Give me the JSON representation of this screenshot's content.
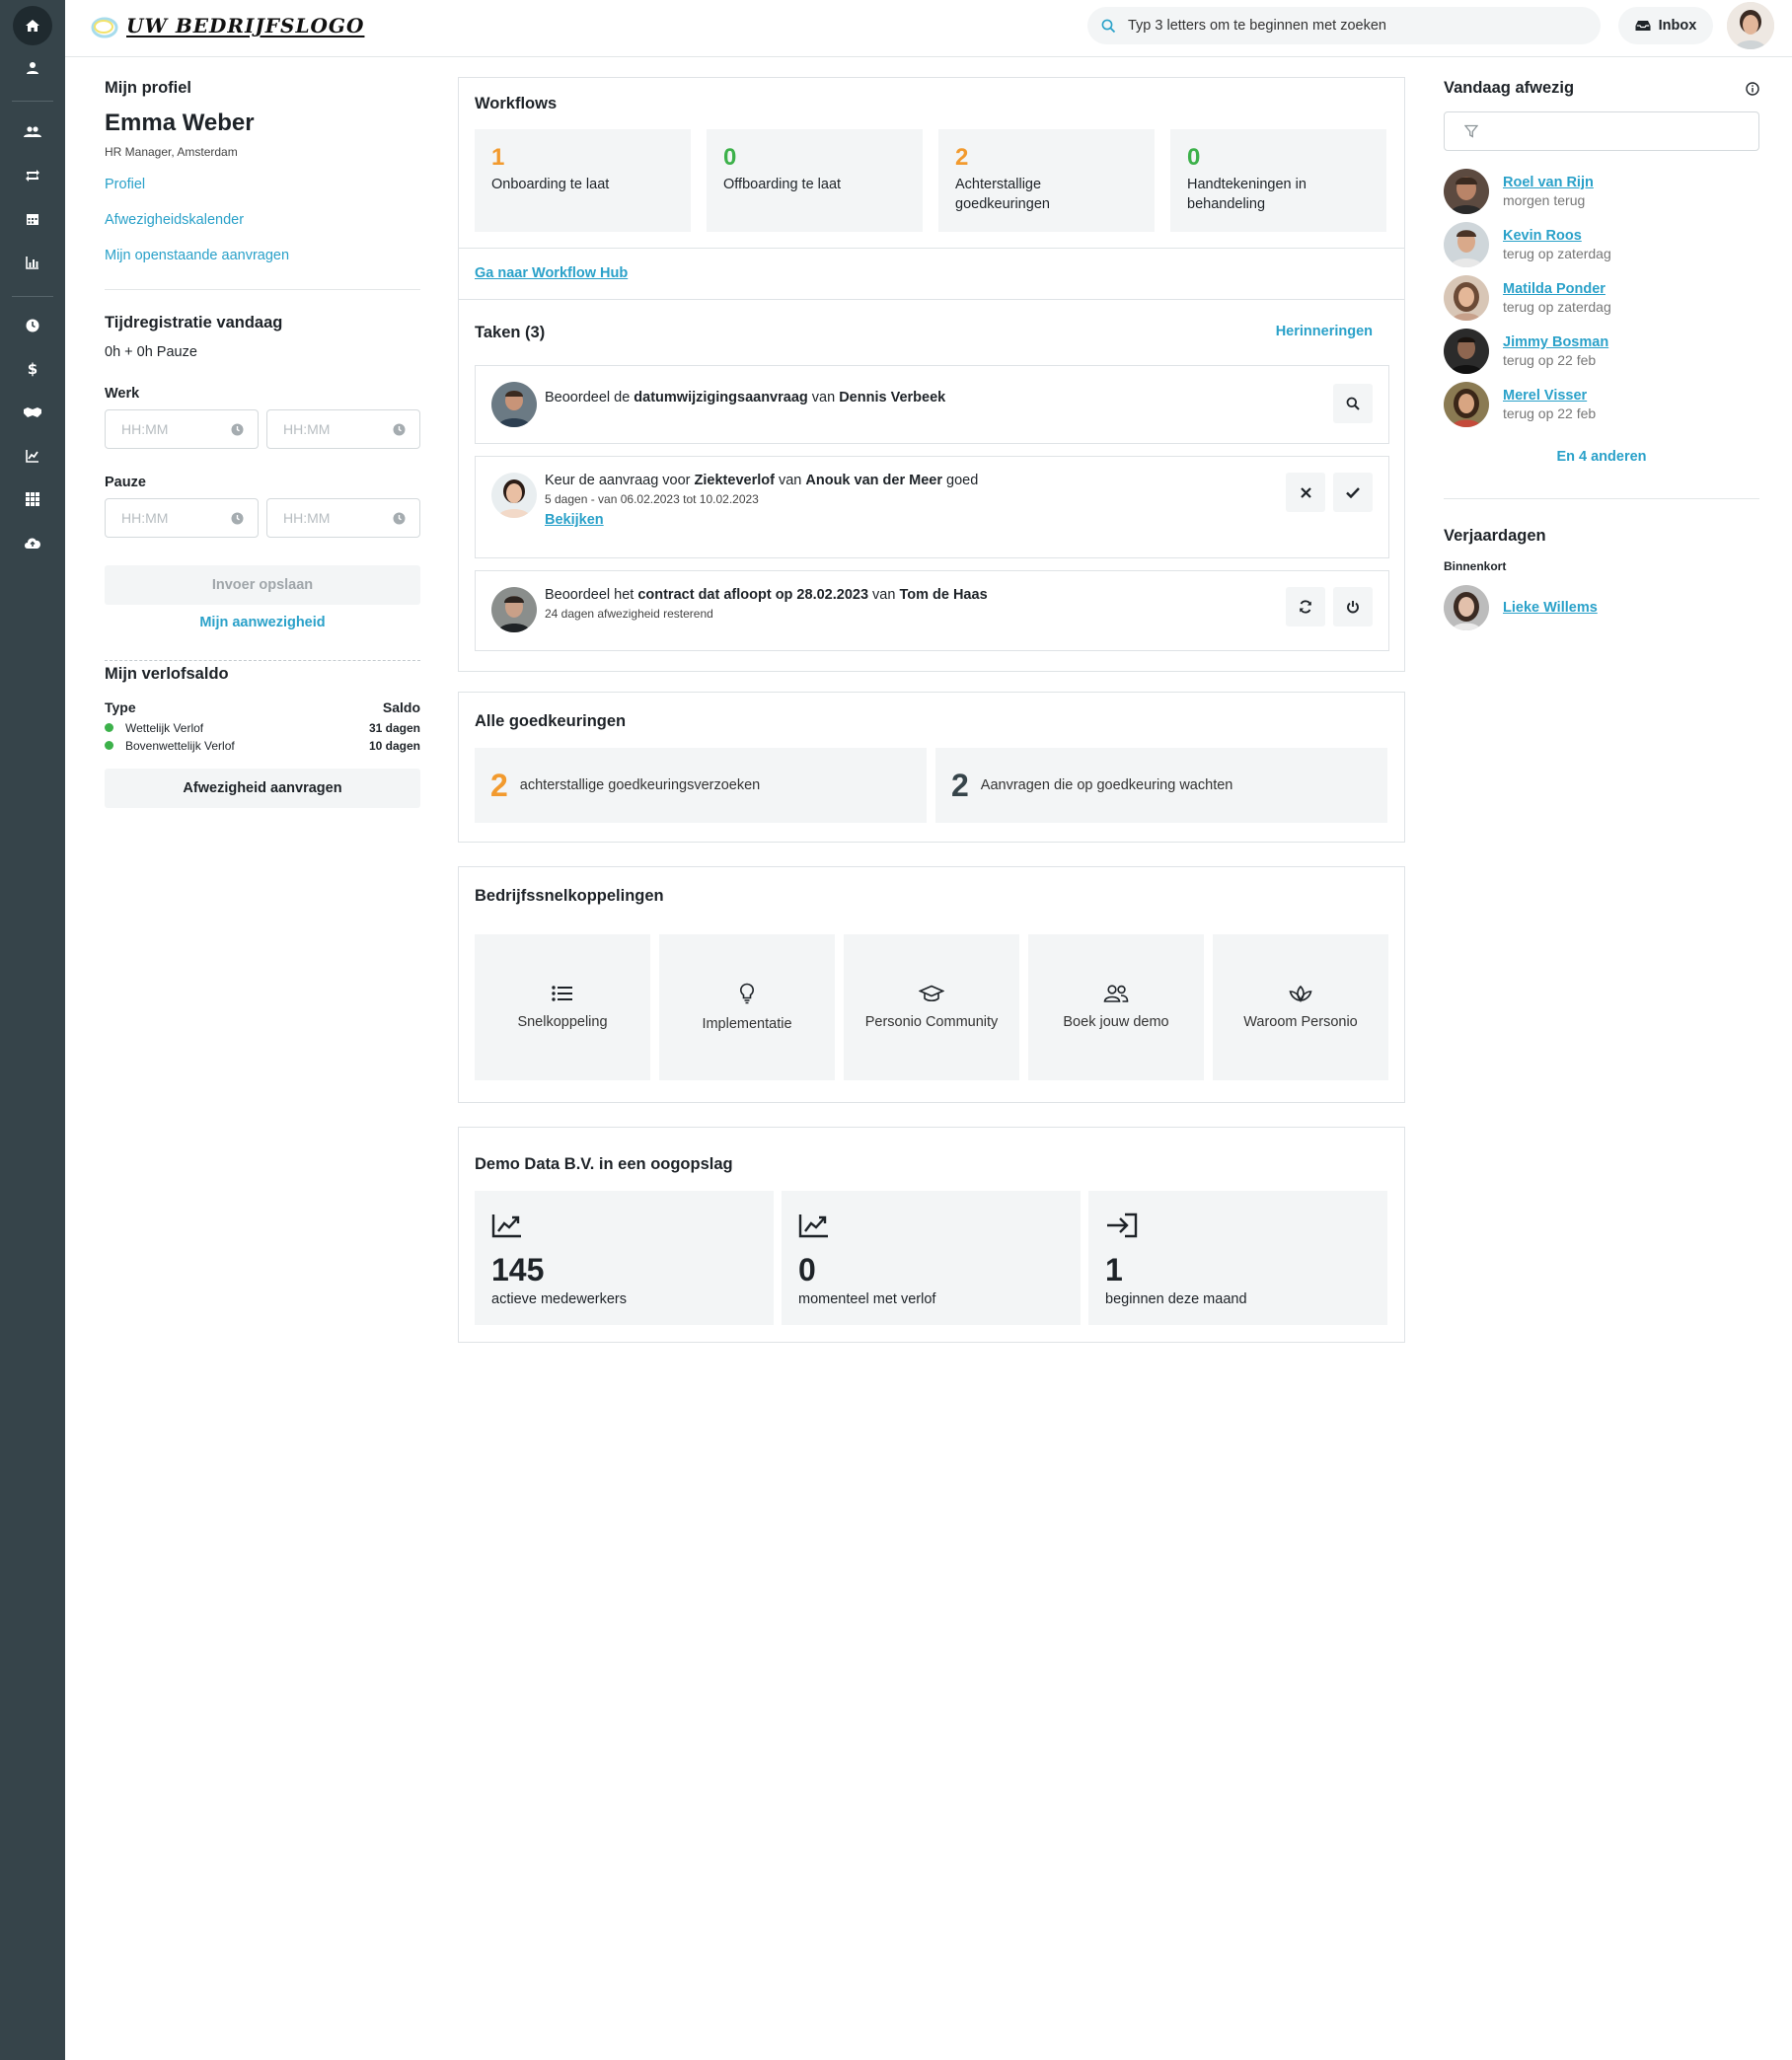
{
  "topbar": {
    "logo_text": "UW BEDRIJFSLOGO",
    "search_placeholder": "Typ 3 letters om te beginnen met zoeken",
    "inbox_label": "Inbox"
  },
  "rail": {
    "icons": [
      "home-icon",
      "person-icon",
      "people-icon",
      "switch-icon",
      "calendar-icon",
      "chart-icon",
      "clock-icon",
      "dollar-icon",
      "handshake-icon",
      "trend-icon",
      "grid-icon",
      "cloud-upload-icon"
    ]
  },
  "profile": {
    "section_title": "Mijn profiel",
    "name": "Emma Weber",
    "role": "HR Manager, Amsterdam",
    "links": [
      "Profiel",
      "Afwezigheidskalender",
      "Mijn openstaande aanvragen"
    ]
  },
  "time": {
    "title": "Tijdregistratie vandaag",
    "summary": "0h + 0h Pauze",
    "werk_label": "Werk",
    "pauze_label": "Pauze",
    "placeholder": "HH:MM",
    "save_label": "Invoer opslaan",
    "attendance_link": "Mijn aanwezigheid"
  },
  "leave": {
    "title": "Mijn verlofsaldo",
    "type_header": "Type",
    "saldo_header": "Saldo",
    "rows": [
      {
        "type": "Wettelijk Verlof",
        "saldo": "31 dagen"
      },
      {
        "type": "Bovenwettelijk Verlof",
        "saldo": "10 dagen"
      }
    ],
    "request_label": "Afwezigheid aanvragen"
  },
  "workflows": {
    "title": "Workflows",
    "tiles": [
      {
        "num": "1",
        "label": "Onboarding te laat",
        "color": "#f29a2e"
      },
      {
        "num": "0",
        "label": "Offboarding te laat",
        "color": "#3cb14a"
      },
      {
        "num": "2",
        "label": "Achterstallige goedkeuringen",
        "color": "#f29a2e"
      },
      {
        "num": "0",
        "label": "Handtekeningen in behandeling",
        "color": "#3cb14a"
      }
    ],
    "hub_link": "Ga naar Workflow Hub"
  },
  "tasks": {
    "title": "Taken (3)",
    "reminders": "Herinneringen",
    "t1": {
      "a": "Beoordeel de ",
      "b": "datumwijzigingsaanvraag",
      "c": " van ",
      "d": "Dennis Verbeek"
    },
    "t2": {
      "a": "Keur de aanvraag voor ",
      "b": "Ziekteverlof",
      "c": " van ",
      "d": "Anouk van der Meer",
      "e": " goed",
      "sub": "5 dagen - van 06.02.2023 tot 10.02.2023",
      "link": "Bekijken"
    },
    "t3": {
      "a": "Beoordeel het ",
      "b": "contract dat afloopt op 28.02.2023",
      "c": " van ",
      "d": "Tom de Haas",
      "sub": "24 dagen afwezigheid resterend"
    }
  },
  "approvals": {
    "title": "Alle goedkeuringen",
    "tiles": [
      {
        "num": "2",
        "label": "achterstallige goedkeuringsverzoeken",
        "color": "#f29a2e"
      },
      {
        "num": "2",
        "label": "Aanvragen die op goedkeuring wachten",
        "color": "#36444a"
      }
    ]
  },
  "shortcuts": {
    "title": "Bedrijfssnelkoppelingen",
    "items": [
      {
        "label": "Snelkoppeling",
        "icon": "list-icon"
      },
      {
        "label": "Implementatie",
        "icon": "lightbulb-icon"
      },
      {
        "label": "Personio Community",
        "icon": "graduation-cap-icon"
      },
      {
        "label": "Boek jouw demo",
        "icon": "people-icon"
      },
      {
        "label": "Waroom Personio",
        "icon": "lotus-icon"
      }
    ]
  },
  "overview": {
    "title": "Demo Data B.V. in een oogopslag",
    "tiles": [
      {
        "num": "145",
        "label": "actieve medewerkers",
        "icon": "trend-up-icon"
      },
      {
        "num": "0",
        "label": "momenteel met verlof",
        "icon": "trend-up-icon"
      },
      {
        "num": "1",
        "label": "beginnen deze maand",
        "icon": "sign-in-icon"
      }
    ]
  },
  "absent": {
    "title": "Vandaag afwezig",
    "people": [
      {
        "name": "Roel van Rijn",
        "status": "morgen terug"
      },
      {
        "name": "Kevin Roos",
        "status": "terug op zaterdag"
      },
      {
        "name": "Matilda Ponder",
        "status": "terug op zaterdag"
      },
      {
        "name": "Jimmy Bosman",
        "status": "terug op 22 feb"
      },
      {
        "name": "Merel Visser",
        "status": "terug op 22 feb"
      }
    ],
    "more": "En 4 anderen"
  },
  "birthdays": {
    "title": "Verjaardagen",
    "subtitle": "Binnenkort",
    "person": "Lieke Willems"
  },
  "colors": {
    "accent": "#2aa1c9",
    "rail": "#36444a",
    "orange": "#f29a2e",
    "green": "#3cb14a"
  }
}
